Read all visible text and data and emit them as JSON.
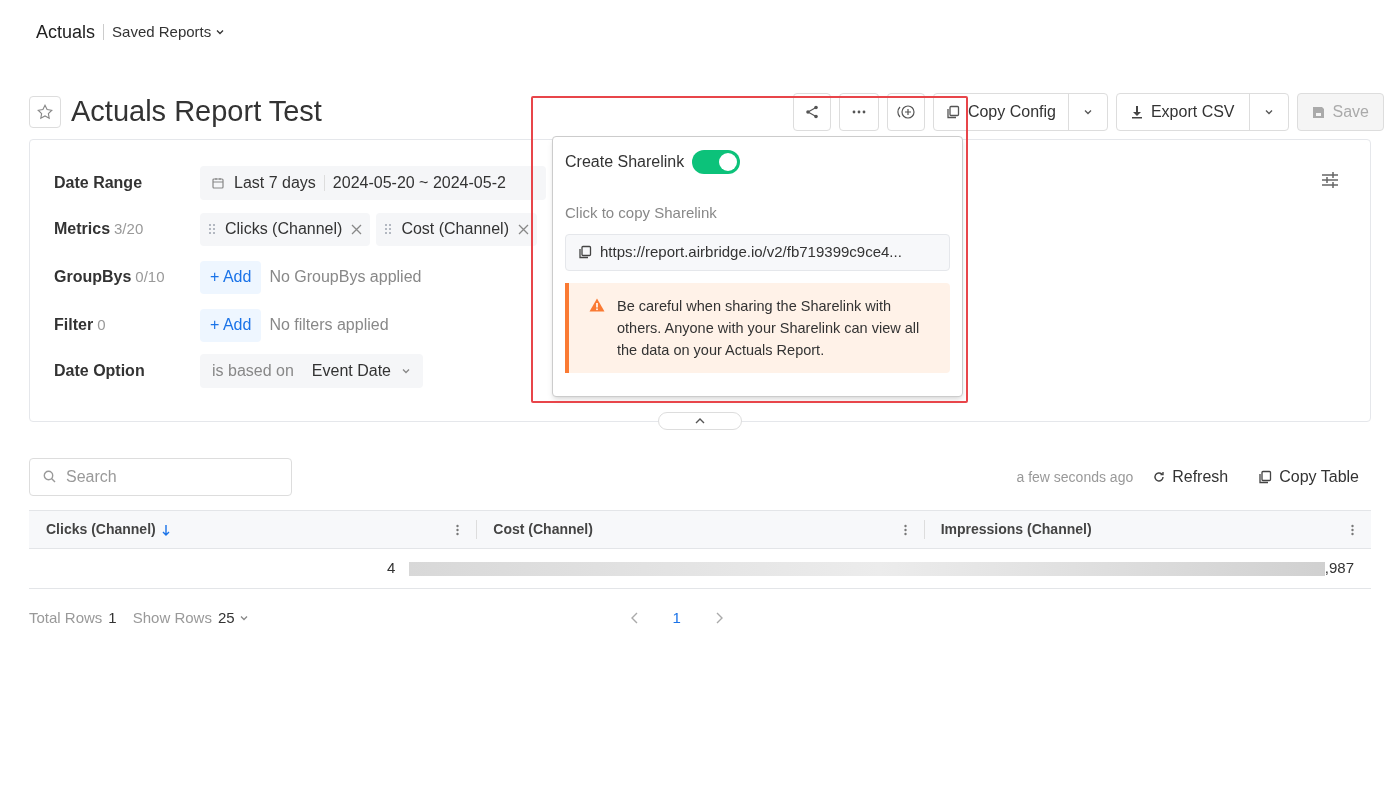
{
  "breadcrumb": {
    "title": "Actuals",
    "menu": "Saved Reports"
  },
  "report": {
    "title": "Actuals Report Test",
    "starred": false
  },
  "toolbar": {
    "copy_config": "Copy Config",
    "export_csv": "Export CSV",
    "save": "Save",
    "save_disabled": true
  },
  "filters": {
    "date_range": {
      "label": "Date Range",
      "preset": "Last 7 days",
      "dates": "2024-05-20 ~ 2024-05-2"
    },
    "metrics": {
      "label": "Metrics",
      "count": "3/20",
      "chips": [
        {
          "text": "Clicks (Channel)"
        },
        {
          "text": "Cost (Channel)"
        }
      ]
    },
    "groupbys": {
      "label": "GroupBys",
      "count": "0/10",
      "add": "+ Add",
      "empty": "No GroupBys applied"
    },
    "filter": {
      "label": "Filter",
      "count": "0",
      "add": "+ Add",
      "empty": "No filters applied"
    },
    "date_option": {
      "label": "Date Option",
      "prefix": "is based on",
      "value": "Event Date"
    }
  },
  "sharelink_popover": {
    "title": "Create Sharelink",
    "on": true,
    "hint": "Click to copy Sharelink",
    "url": "https://report.airbridge.io/v2/fb719399c9ce4...",
    "warning": "Be careful when sharing the Sharelink with others. Anyone with your Sharelink can view all the data on your Actuals Report."
  },
  "table_toolbar": {
    "search_placeholder": "Search",
    "updated": "a few seconds ago",
    "refresh": "Refresh",
    "copy_table": "Copy Table"
  },
  "table": {
    "columns": [
      {
        "label": "Clicks (Channel)",
        "sorted": true
      },
      {
        "label": "Cost (Channel)",
        "sorted": false
      },
      {
        "label": "Impressions (Channel)",
        "sorted": false
      }
    ],
    "rows": [
      [
        "4",
        "",
        ",987"
      ]
    ]
  },
  "footer": {
    "total_label": "Total Rows",
    "total": "1",
    "show_label": "Show Rows",
    "show": "25",
    "pages": [
      {
        "label": "1",
        "selected": true
      }
    ]
  }
}
